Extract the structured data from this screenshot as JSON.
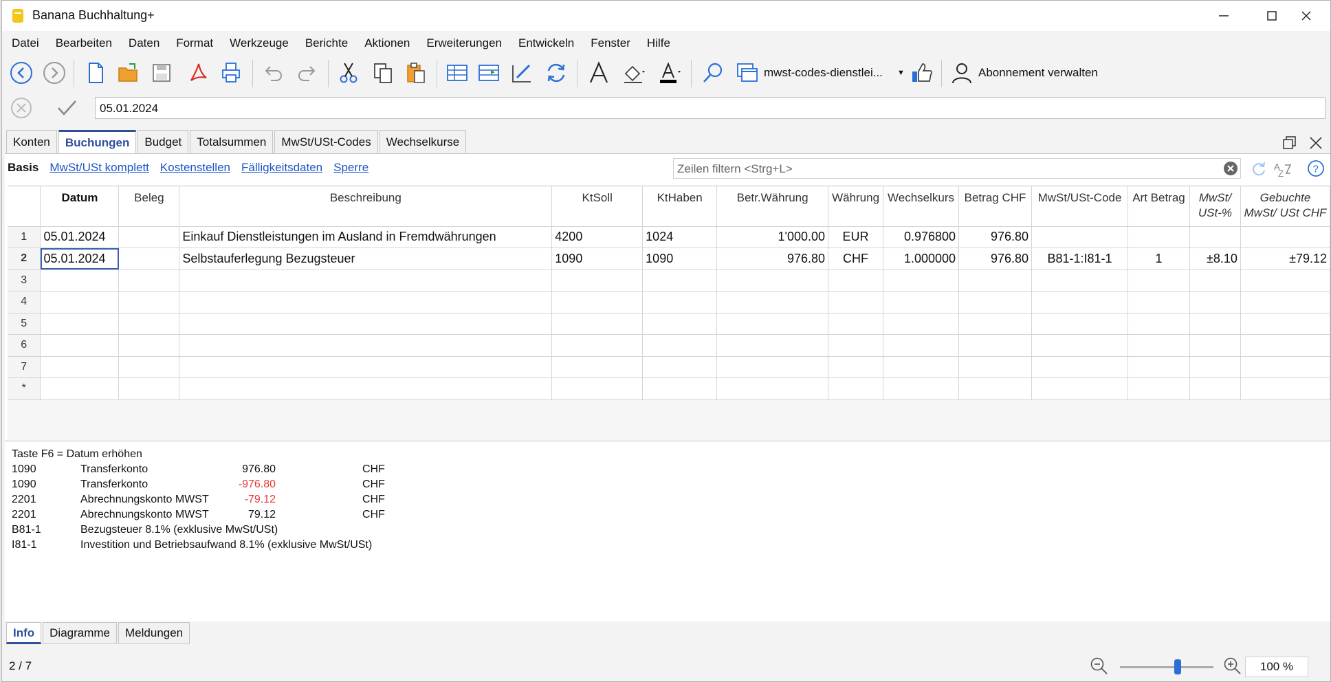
{
  "window": {
    "title": "Banana Buchhaltung+"
  },
  "menu": [
    "Datei",
    "Bearbeiten",
    "Daten",
    "Format",
    "Werkzeuge",
    "Berichte",
    "Aktionen",
    "Erweiterungen",
    "Entwickeln",
    "Fenster",
    "Hilfe"
  ],
  "toolbar": {
    "file_dropdown": "mwst-codes-dienstlei...",
    "subscription": "Abonnement verwalten"
  },
  "input_line": {
    "value": "05.01.2024"
  },
  "tabs": [
    "Konten",
    "Buchungen",
    "Budget",
    "Totalsummen",
    "MwSt/USt-Codes",
    "Wechselkurse"
  ],
  "active_tab": "Buchungen",
  "views": {
    "active": "Basis",
    "links": [
      "MwSt/USt komplett",
      "Kostenstellen",
      "Fälligkeitsdaten",
      "Sperre"
    ]
  },
  "filter": {
    "placeholder": "Zeilen filtern <Strg+L>"
  },
  "table": {
    "headers": [
      "Datum",
      "Beleg",
      "Beschreibung",
      "KtSoll",
      "KtHaben",
      "Betr.Währung",
      "Währung",
      "Wechselkurs",
      "Betrag CHF",
      "MwSt/USt-Code",
      "Art Betrag",
      "MwSt/ USt-%",
      "Gebuchte MwSt/ USt CHF"
    ],
    "rows": [
      {
        "num": "1",
        "cells": [
          "05.01.2024",
          "",
          "Einkauf Dienstleistungen im Ausland in Fremdwährungen",
          "4200",
          "1024",
          "1'000.00",
          "EUR",
          "0.976800",
          "976.80",
          "",
          "",
          "",
          ""
        ]
      },
      {
        "num": "2",
        "cells": [
          "05.01.2024",
          "",
          "Selbstauferlegung Bezugsteuer",
          "1090",
          "1090",
          "976.80",
          "CHF",
          "1.000000",
          "976.80",
          "B81-1:I81-1",
          "1",
          "±8.10",
          "±79.12"
        ]
      },
      {
        "num": "3",
        "cells": [
          "",
          "",
          "",
          "",
          "",
          "",
          "",
          "",
          "",
          "",
          "",
          "",
          ""
        ]
      },
      {
        "num": "4",
        "cells": [
          "",
          "",
          "",
          "",
          "",
          "",
          "",
          "",
          "",
          "",
          "",
          "",
          ""
        ]
      },
      {
        "num": "5",
        "cells": [
          "",
          "",
          "",
          "",
          "",
          "",
          "",
          "",
          "",
          "",
          "",
          "",
          ""
        ]
      },
      {
        "num": "6",
        "cells": [
          "",
          "",
          "",
          "",
          "",
          "",
          "",
          "",
          "",
          "",
          "",
          "",
          ""
        ]
      },
      {
        "num": "7",
        "cells": [
          "",
          "",
          "",
          "",
          "",
          "",
          "",
          "",
          "",
          "",
          "",
          "",
          ""
        ]
      },
      {
        "num": "*",
        "cells": [
          "",
          "",
          "",
          "",
          "",
          "",
          "",
          "",
          "",
          "",
          "",
          "",
          ""
        ]
      }
    ]
  },
  "info": {
    "hint": "Taste F6 = Datum erhöhen",
    "lines": [
      {
        "code": "1090",
        "text": "Transferkonto",
        "amount": "976.80",
        "negative": false,
        "currency": "CHF"
      },
      {
        "code": "1090",
        "text": "Transferkonto",
        "amount": "-976.80",
        "negative": true,
        "currency": "CHF"
      },
      {
        "code": "2201",
        "text": "Abrechnungskonto MWST",
        "amount": "-79.12",
        "negative": true,
        "currency": "CHF"
      },
      {
        "code": "2201",
        "text": "Abrechnungskonto MWST",
        "amount": "79.12",
        "negative": false,
        "currency": "CHF"
      },
      {
        "code": "B81-1",
        "text": "Bezugsteuer 8.1% (exklusive MwSt/USt)",
        "amount": "",
        "negative": false,
        "currency": ""
      },
      {
        "code": "I81-1",
        "text": "Investition und Betriebsaufwand 8.1% (exklusive MwSt/USt)",
        "amount": "",
        "negative": false,
        "currency": ""
      }
    ]
  },
  "bottom_tabs": [
    "Info",
    "Diagramme",
    "Meldungen"
  ],
  "status": {
    "row_position": "2 / 7",
    "zoom": "100 %",
    "zoom_level": 1.0
  },
  "colors": {
    "accent": "#2e4f9c",
    "link": "#1a55c6",
    "negative": "#e53935"
  }
}
